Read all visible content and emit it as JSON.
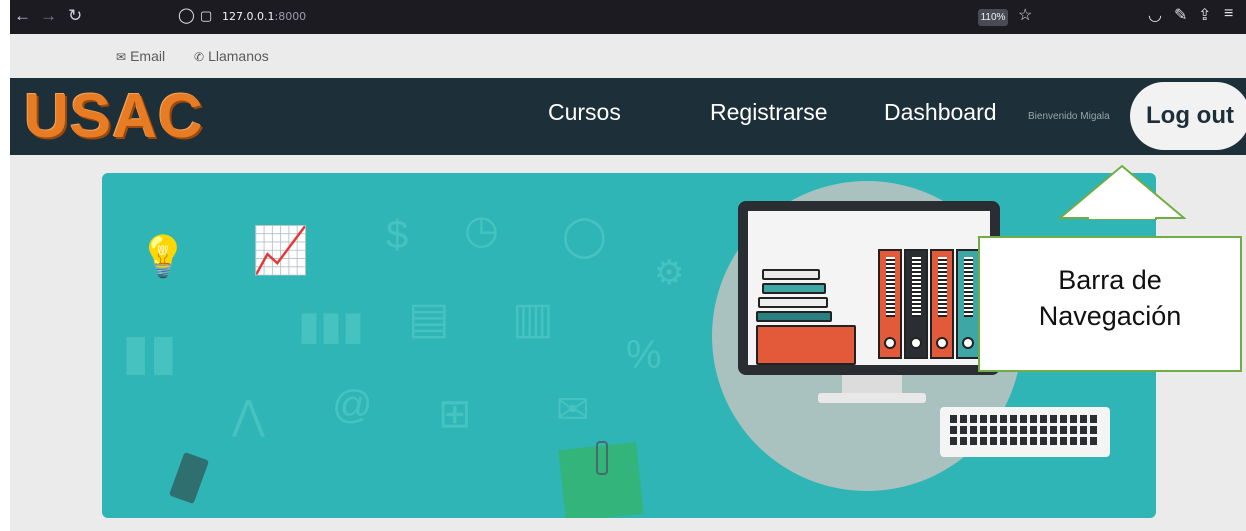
{
  "browser": {
    "url_host": "127.0.0.1",
    "url_port": ":8000",
    "zoom": "110%"
  },
  "contact": {
    "email": "Email",
    "call": "Llamanos"
  },
  "navbar": {
    "logo": "USAC",
    "links": [
      "Cursos",
      "Registrarse",
      "Dashboard"
    ],
    "welcome": "Bienvenido Migala",
    "logout": "Log out"
  },
  "annotation": {
    "line1": "Barra de",
    "line2": "Navegación"
  },
  "colors": {
    "navbar_bg": "#1d2f38",
    "logo": "#e87c24",
    "hero_bg": "#2fb5b5",
    "annotation_border": "#70ad47"
  }
}
